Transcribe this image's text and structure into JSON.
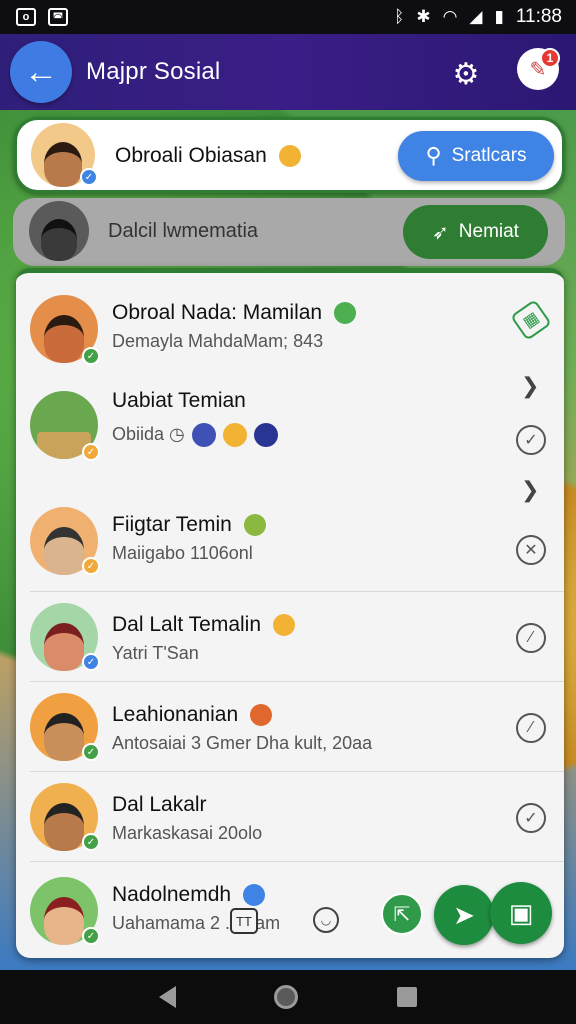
{
  "status_bar": {
    "time": "11:88",
    "left_icons": [
      "notification-icon",
      "image-icon"
    ],
    "right_icons": [
      "bluetooth-icon",
      "vibrate-icon",
      "wifi-icon",
      "signal-icon",
      "battery-icon"
    ]
  },
  "app_bar": {
    "title": "Majpr Sosial",
    "back_icon": "arrow-left-icon",
    "settings_icon": "gear-icon",
    "notification_badge": "1"
  },
  "featured": {
    "title": "Obroali Obiasan",
    "search_label": "Sratlcars",
    "accent": "#3f84e5"
  },
  "secondary": {
    "title": "Dalcil lwmematia",
    "join_label": "Nemiat",
    "accent": "#2e7d32"
  },
  "list": [
    {
      "name": "Obroal Nada: Mamilan",
      "subtitle": "Demayla MahdaMam; 843",
      "action_icon": "bandage-icon"
    },
    {
      "name": "Uabiat Temian",
      "subtitle": "Obiida",
      "action_icon": "check-circle-icon",
      "extra_icon": "chevron-right-icon"
    },
    {
      "name": "Fiigtar Temin",
      "subtitle": "Maiigabo 1106onl",
      "action_icon": "x-circle-icon",
      "extra_icon": "chevron-right-icon"
    },
    {
      "name": "Dal Lalt Temalin",
      "subtitle": "Yatri T'San",
      "action_icon": "slash-circle-icon"
    },
    {
      "name": "Leahionanian",
      "subtitle": "Antosaiai 3 Gmer Dha kult, 20aa",
      "action_icon": "slash-circle-icon"
    },
    {
      "name": "Dal Lakalr",
      "subtitle": "Markaskasai 20olo",
      "action_icon": "check-circle-icon"
    },
    {
      "name": "Nadolnemdh",
      "subtitle": "Uahamama 2 ... aam",
      "action_icon": "share-icon"
    }
  ],
  "bottom_box_label": "TT",
  "colors": {
    "app_bar": "#3a1d86",
    "green": "#2e7d32",
    "blue": "#3f84e5"
  }
}
